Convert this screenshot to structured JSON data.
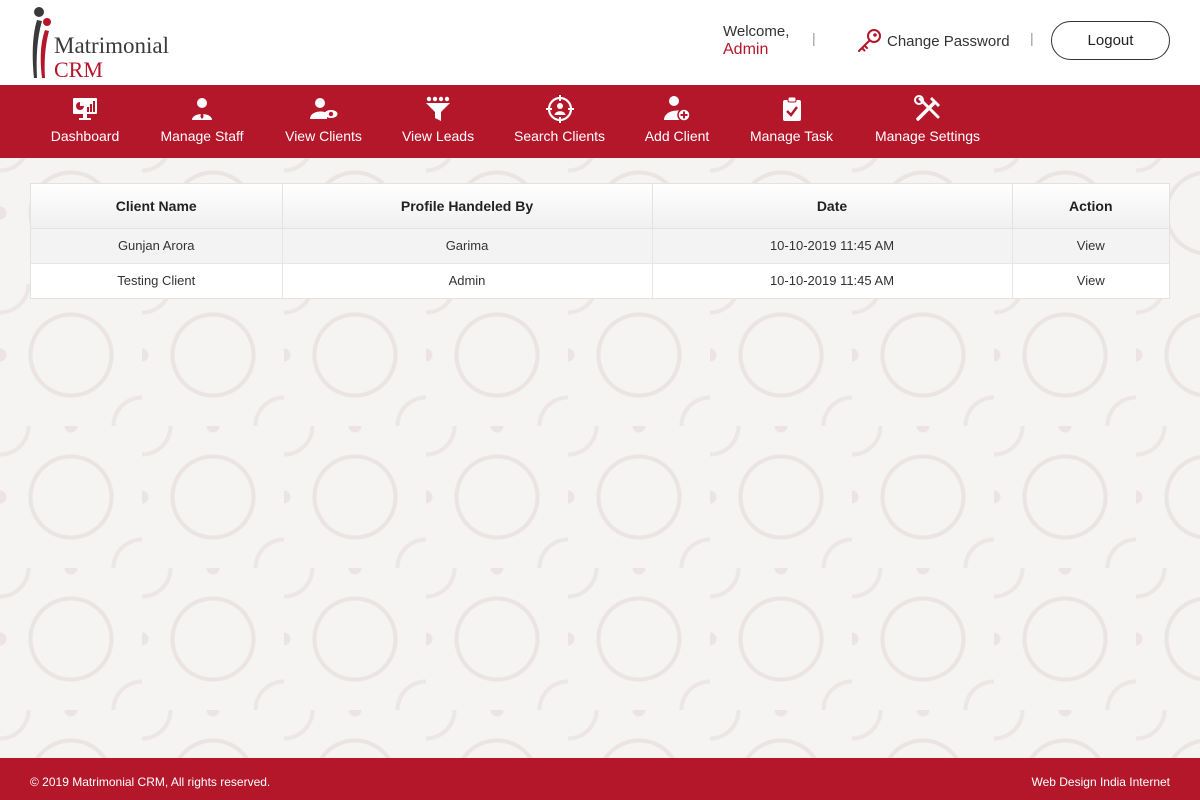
{
  "brand": {
    "name_line1": "Matrimonial",
    "name_line2": "CRM",
    "accent_color": "#b4162a"
  },
  "header": {
    "welcome_label": "Welcome,",
    "username": "Admin",
    "separator": "|",
    "change_password_label": "Change Password",
    "change_password_icon": "key-icon",
    "logout_label": "Logout"
  },
  "nav": {
    "items": [
      {
        "label": "Dashboard",
        "icon": "dashboard-icon"
      },
      {
        "label": "Manage Staff",
        "icon": "staff-icon"
      },
      {
        "label": "View Clients",
        "icon": "view-clients-icon"
      },
      {
        "label": "View Leads",
        "icon": "funnel-icon"
      },
      {
        "label": "Search Clients",
        "icon": "target-search-icon"
      },
      {
        "label": "Add Client",
        "icon": "add-user-icon"
      },
      {
        "label": "Manage Task",
        "icon": "clipboard-check-icon"
      },
      {
        "label": "Manage Settings",
        "icon": "tools-icon"
      }
    ]
  },
  "table": {
    "columns": [
      "Client Name",
      "Profile Handeled By",
      "Date",
      "Action"
    ],
    "rows": [
      {
        "client_name": "Gunjan Arora",
        "handled_by": "Garima",
        "date": "10-10-2019 11:45 AM",
        "action": "View"
      },
      {
        "client_name": "Testing Client",
        "handled_by": "Admin",
        "date": "10-10-2019 11:45 AM",
        "action": "View"
      }
    ]
  },
  "footer": {
    "copyright": "© 2019 Matrimonial CRM, All rights reserved.",
    "credit": "Web Design India Internet"
  }
}
